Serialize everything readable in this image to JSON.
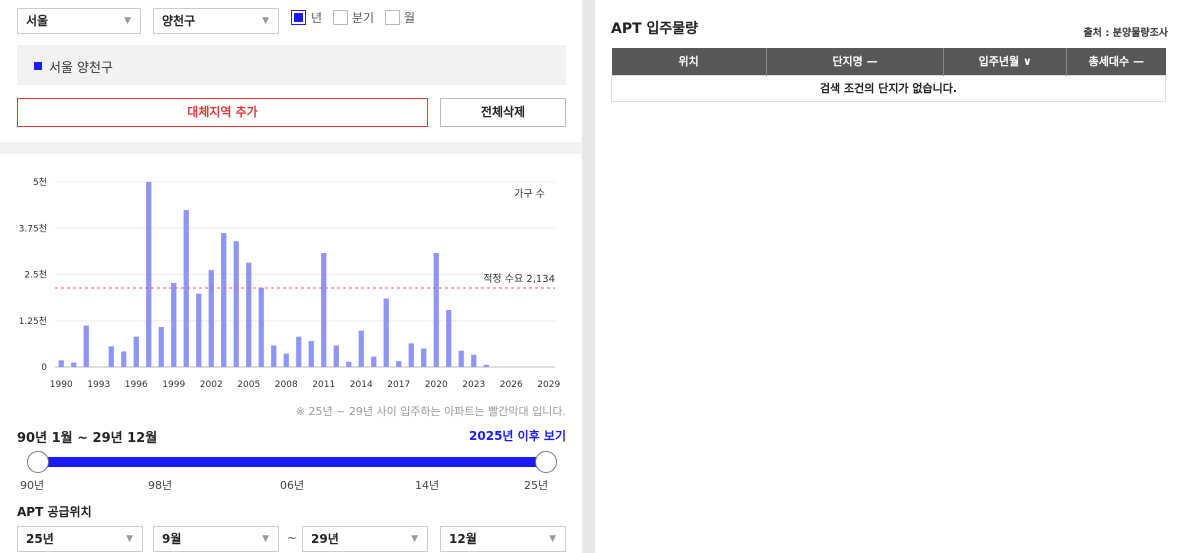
{
  "filters": {
    "city": "서울",
    "district": "양천구",
    "period_options": [
      {
        "label": "년",
        "checked": true
      },
      {
        "label": "분기",
        "checked": false
      },
      {
        "label": "월",
        "checked": false
      }
    ]
  },
  "selected_region": "서울 양천구",
  "buttons": {
    "add_region": "대체지역 추가",
    "delete_all": "전체삭제"
  },
  "chart_data": {
    "type": "bar",
    "legend_label": "가구 수",
    "reference_label": "적정 수요 2,134",
    "reference_value": 2134,
    "y_ticks": [
      "0",
      "1.25천",
      "2.5천",
      "3.75천",
      "5천"
    ],
    "ylim": [
      0,
      5000
    ],
    "x_ticks": [
      "1990",
      "1993",
      "1996",
      "1999",
      "2002",
      "2005",
      "2008",
      "2011",
      "2014",
      "2017",
      "2020",
      "2023",
      "2026",
      "2029"
    ],
    "x": [
      1990,
      1991,
      1992,
      1993,
      1994,
      1995,
      1996,
      1997,
      1998,
      1999,
      2000,
      2001,
      2002,
      2003,
      2004,
      2005,
      2006,
      2007,
      2008,
      2009,
      2010,
      2011,
      2012,
      2013,
      2014,
      2015,
      2016,
      2017,
      2018,
      2019,
      2020,
      2021,
      2022,
      2023,
      2024,
      2025,
      2026,
      2027,
      2028,
      2029
    ],
    "values": [
      180,
      120,
      1120,
      0,
      560,
      420,
      820,
      5000,
      1080,
      2270,
      4240,
      1980,
      2620,
      3620,
      3400,
      2820,
      2140,
      580,
      360,
      820,
      700,
      3080,
      580,
      140,
      980,
      280,
      1850,
      160,
      640,
      500,
      3080,
      1540,
      440,
      330,
      60,
      0,
      0,
      0,
      0,
      0
    ],
    "bar_color": "#8f95f5",
    "reference_color": "#e06060"
  },
  "chart_note": "※ 25년 ~ 29년 사이 입주하는 아파트는 빨간막대 입니다.",
  "range_label": "90년 1월 ~ 29년 12월",
  "after_link": "2025년 이후 보기",
  "slider": {
    "labels": [
      "90년",
      "98년",
      "06년",
      "14년",
      "25년"
    ]
  },
  "supply_title": "APT 공급위치",
  "range_selects": {
    "from_year": "25년",
    "from_month": "9월",
    "separator": "~",
    "to_year": "29년",
    "to_month": "12월"
  },
  "apt": {
    "title": "APT 입주물량",
    "source": "출처 : 분양물량조사",
    "headers": [
      "위치",
      "단지명 —",
      "입주년월 ∨",
      "총세대수 —"
    ],
    "empty_message": "검색 조건의 단지가 없습니다."
  }
}
